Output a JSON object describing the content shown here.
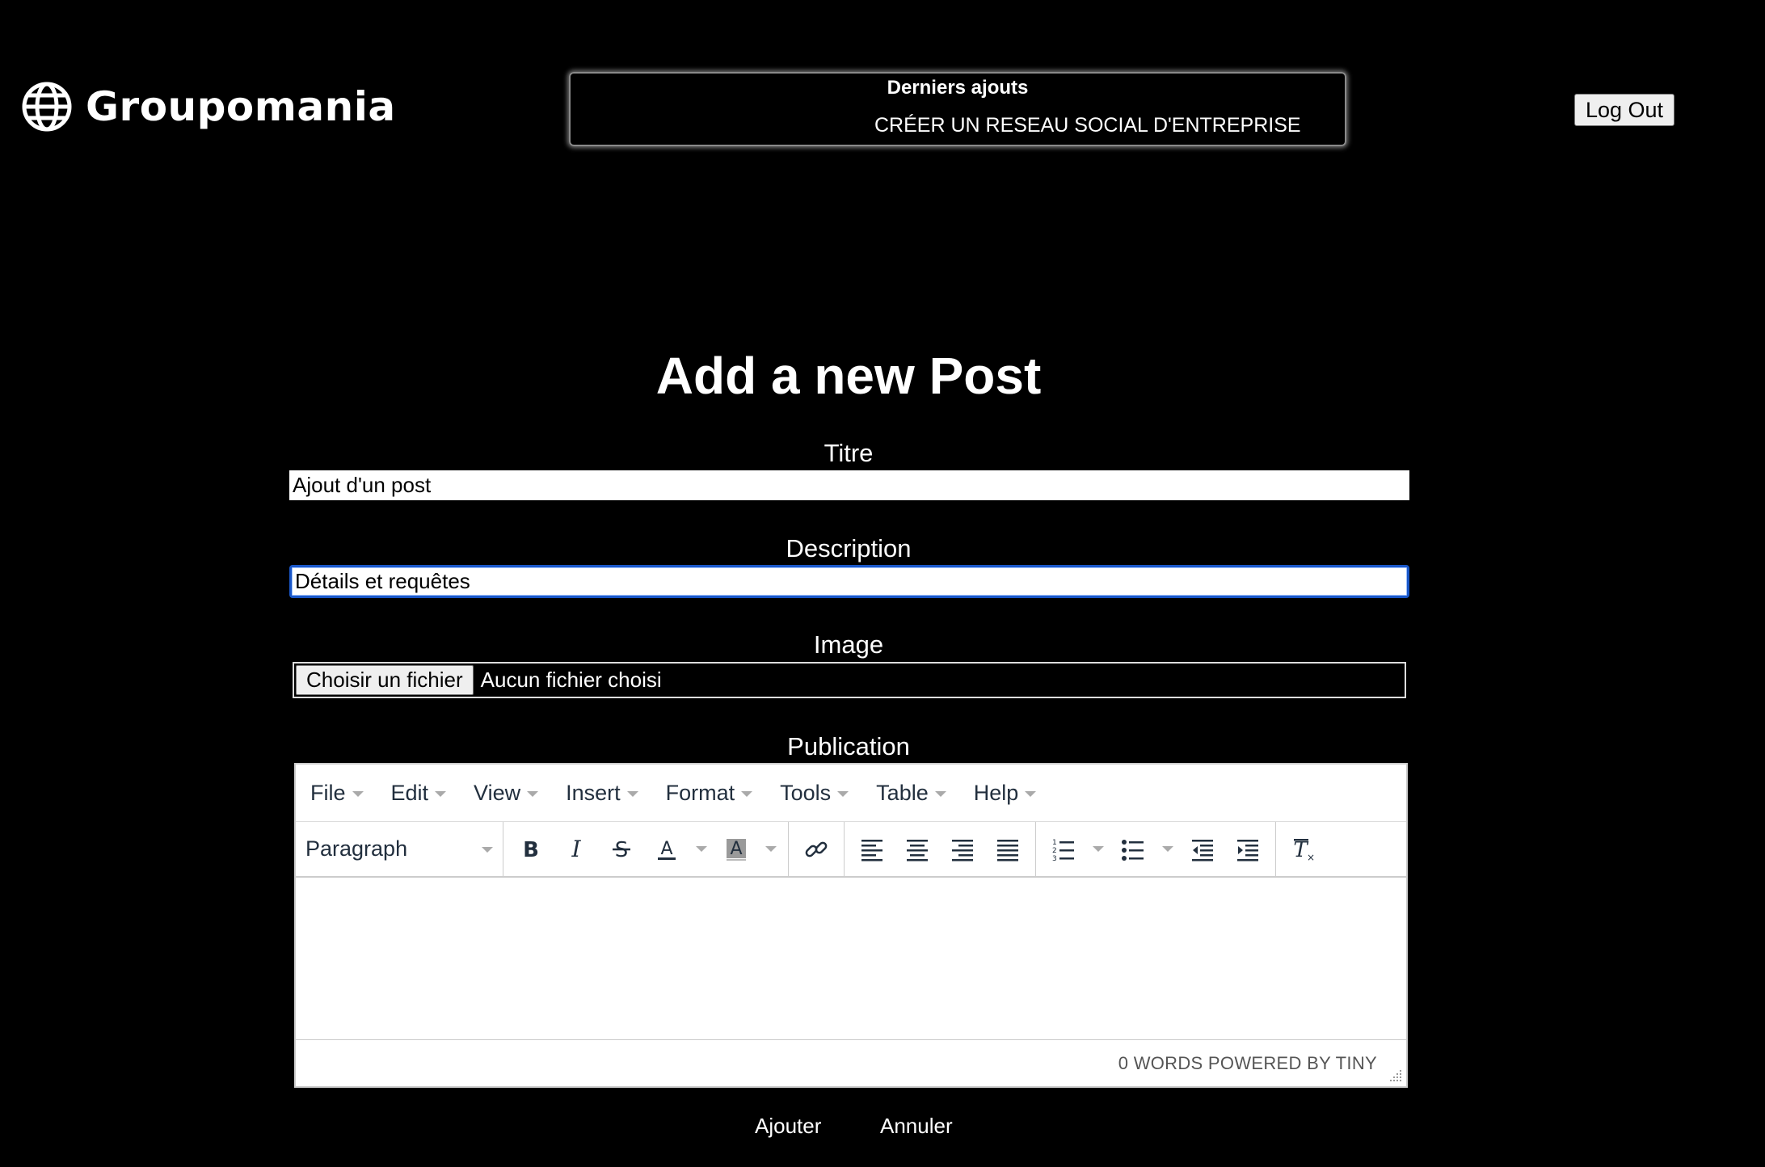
{
  "header": {
    "brand": "Groupomania",
    "news_title": "Derniers ajouts",
    "news_item": "CRÉER UN RESEAU SOCIAL D'ENTREPRISE",
    "logout": "Log Out"
  },
  "form": {
    "heading": "Add a new Post",
    "title_label": "Titre",
    "title_value": "Ajout d'un post",
    "description_label": "Description",
    "description_value": "Détails et requêtes",
    "image_label": "Image",
    "file_button": "Choisir un fichier",
    "file_status": "Aucun fichier choisi",
    "publication_label": "Publication"
  },
  "editor": {
    "menus": [
      "File",
      "Edit",
      "View",
      "Insert",
      "Format",
      "Tools",
      "Table",
      "Help"
    ],
    "block_format": "Paragraph",
    "status": "0 WORDS POWERED BY TINY"
  },
  "actions": {
    "add": "Ajouter",
    "cancel": "Annuler"
  },
  "colors": {
    "background": "#000000",
    "focus_border": "#1a57c8"
  }
}
